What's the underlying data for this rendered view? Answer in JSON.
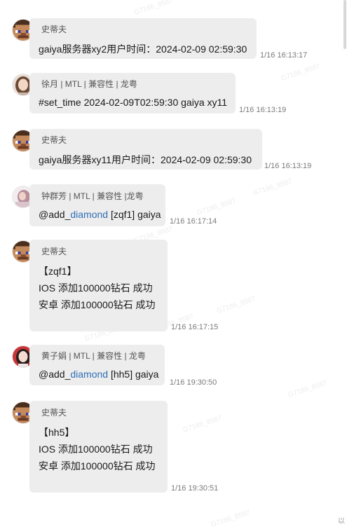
{
  "messages": [
    {
      "sender": "史蒂夫",
      "avatar": "pixel-character-avatar",
      "lines": [
        "gaiya服务器xy2用户时间：2024-02-09 02:59:30"
      ],
      "time": "1/16 16:13:17"
    },
    {
      "sender": "徐月 | MTL | 兼容性 | 龙粤",
      "avatar": "woman-photo-avatar",
      "lines": [
        "#set_time 2024-02-09T02:59:30 gaiya xy11"
      ],
      "time": "1/16 16:13:19"
    },
    {
      "sender": "史蒂夫",
      "avatar": "pixel-character-avatar",
      "lines": [
        "gaiya服务器xy11用户时间：2024-02-09 02:59:30"
      ],
      "time": "1/16 16:13:19"
    },
    {
      "sender": "钟群芳 | MTL | 兼容性 |龙粤",
      "avatar": "woman-photo-avatar",
      "mention": {
        "prefix": "@add_",
        "link": "diamond",
        "suffix": " [zqf1] gaiya"
      },
      "time": "1/16 16:17:14"
    },
    {
      "sender": "史蒂夫",
      "avatar": "pixel-character-avatar",
      "lines": [
        "【zqf1】",
        "IOS 添加100000钻石 成功",
        "安卓 添加100000钻石 成功"
      ],
      "time": "1/16 16:17:15"
    },
    {
      "sender": "黄子娟 | MTL | 兼容性 | 龙粤",
      "avatar": "woman-photo-avatar",
      "mention": {
        "prefix": "@add_",
        "link": "diamond",
        "suffix": " [hh5] gaiya"
      },
      "time": "1/16 19:30:50"
    },
    {
      "sender": "史蒂夫",
      "avatar": "pixel-character-avatar",
      "lines": [
        "【hh5】",
        "IOS 添加100000钻石 成功",
        "安卓 添加100000钻石 成功"
      ],
      "time": "1/16 19:30:51"
    }
  ],
  "watermark": "G7186_8587",
  "corner_glyph": "以"
}
